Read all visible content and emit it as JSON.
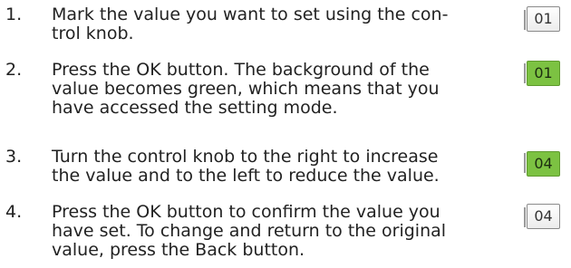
{
  "steps": [
    {
      "number": "1.",
      "lines": [
        "Mark the value you want to set using the con-",
        "trol knob."
      ],
      "value": "01",
      "state": "normal"
    },
    {
      "number": "2.",
      "lines": [
        "Press the OK button. The background of the",
        "value becomes green, which means that you",
        "have accessed the setting mode."
      ],
      "value": "01",
      "state": "active"
    },
    {
      "number": "3.",
      "lines": [
        "Turn the control knob to the right to increase",
        "the value and to the left to reduce the value."
      ],
      "value": "04",
      "state": "active"
    },
    {
      "number": "4.",
      "lines": [
        "Press the OK button to confirm the value you",
        "have set. To change and return to the original",
        "value, press the Back button."
      ],
      "value": "04",
      "state": "normal"
    }
  ],
  "colors": {
    "active_background": "#7cc242",
    "normal_background": "#ffffff",
    "text": "#222222"
  }
}
